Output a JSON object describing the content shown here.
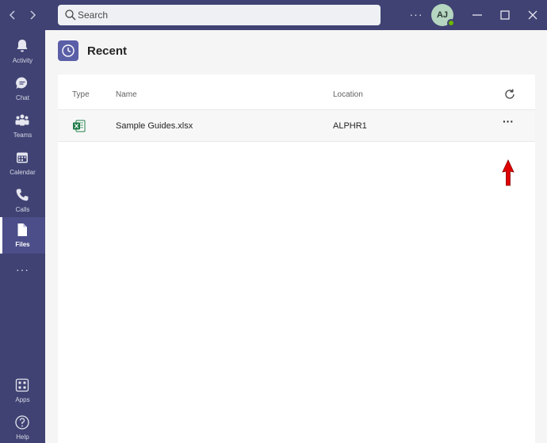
{
  "titlebar": {
    "back_glyph": "‹",
    "forward_glyph": "›",
    "search_placeholder": "Search",
    "more_glyph": "···",
    "avatar_initials": "AJ",
    "avatar_status": "available"
  },
  "rail": {
    "items": [
      {
        "label": "Activity",
        "icon": "bell-icon"
      },
      {
        "label": "Chat",
        "icon": "chat-icon"
      },
      {
        "label": "Teams",
        "icon": "teams-icon"
      },
      {
        "label": "Calendar",
        "icon": "calendar-icon"
      },
      {
        "label": "Calls",
        "icon": "phone-icon"
      },
      {
        "label": "Files",
        "icon": "file-icon",
        "active": true
      }
    ],
    "more_glyph": "···",
    "bottom": [
      {
        "label": "Apps",
        "icon": "apps-icon"
      },
      {
        "label": "Help",
        "icon": "help-icon"
      }
    ]
  },
  "main": {
    "title": "Recent",
    "columns": [
      "Type",
      "Name",
      "Location"
    ],
    "rows": [
      {
        "type_icon": "excel-icon",
        "name": "Sample Guides.xlsx",
        "location": "ALPHR1"
      }
    ],
    "row_more_glyph": "···"
  },
  "colors": {
    "rail": "#3f4272",
    "accent": "#5b5fa7",
    "annotation_arrow": "#e00000",
    "excel_green": "#1d7a45"
  }
}
